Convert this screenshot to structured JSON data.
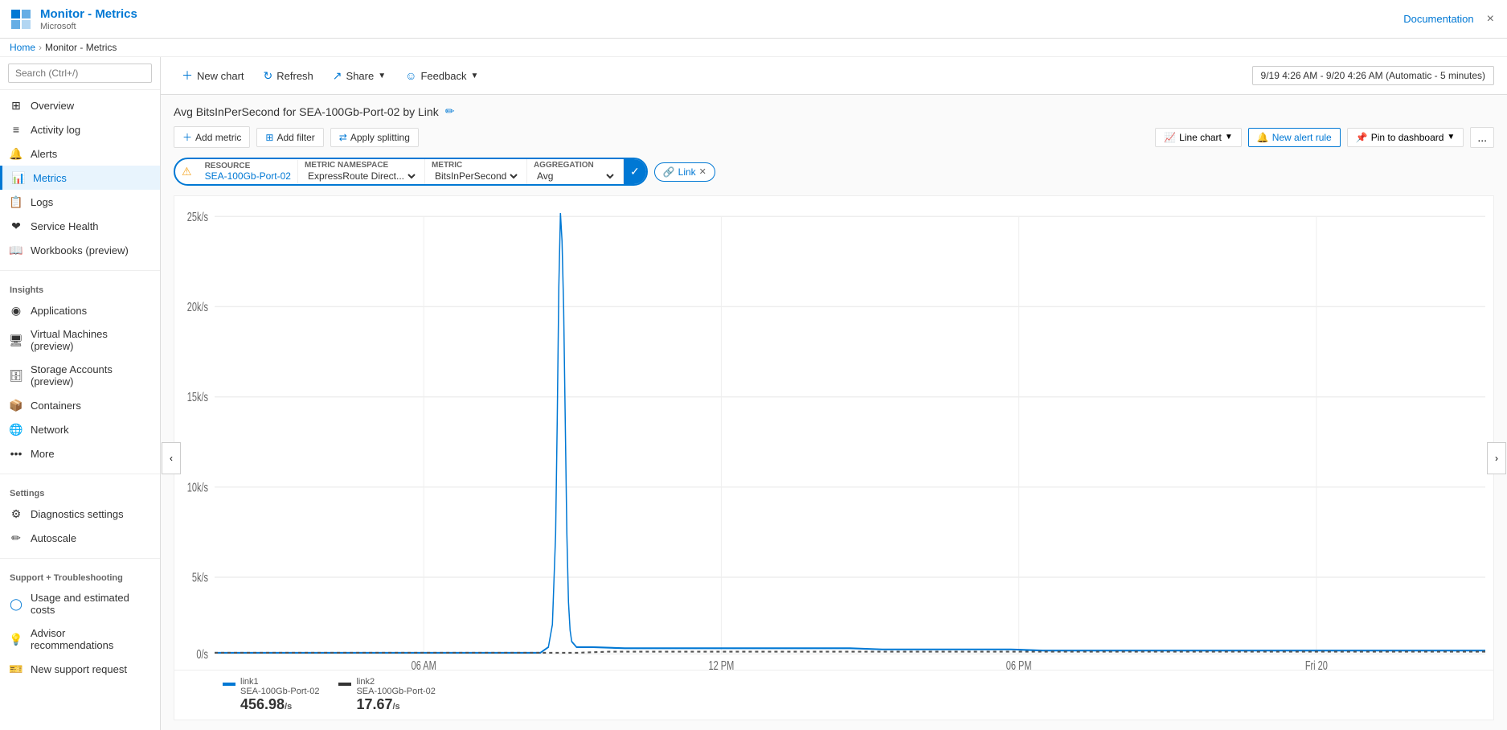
{
  "app": {
    "title": "Monitor - Metrics",
    "subtitle": "Microsoft",
    "documentation_label": "Documentation",
    "close_label": "×"
  },
  "breadcrumb": {
    "home": "Home",
    "current": "Monitor - Metrics"
  },
  "sidebar": {
    "search_placeholder": "Search (Ctrl+/)",
    "items": [
      {
        "id": "overview",
        "label": "Overview",
        "icon": "⊞",
        "active": false
      },
      {
        "id": "activity-log",
        "label": "Activity log",
        "icon": "≡",
        "active": false
      },
      {
        "id": "alerts",
        "label": "Alerts",
        "icon": "🔔",
        "active": false
      },
      {
        "id": "metrics",
        "label": "Metrics",
        "icon": "📊",
        "active": true
      },
      {
        "id": "logs",
        "label": "Logs",
        "icon": "📋",
        "active": false
      },
      {
        "id": "service-health",
        "label": "Service Health",
        "icon": "❤",
        "active": false
      },
      {
        "id": "workbooks",
        "label": "Workbooks (preview)",
        "icon": "📖",
        "active": false
      }
    ],
    "sections": {
      "insights": {
        "label": "Insights",
        "items": [
          {
            "id": "applications",
            "label": "Applications",
            "icon": "◉"
          },
          {
            "id": "virtual-machines",
            "label": "Virtual Machines (preview)",
            "icon": "🖥"
          },
          {
            "id": "storage-accounts",
            "label": "Storage Accounts (preview)",
            "icon": "🗄"
          },
          {
            "id": "containers",
            "label": "Containers",
            "icon": "📦"
          },
          {
            "id": "network",
            "label": "Network",
            "icon": "🌐"
          },
          {
            "id": "more",
            "label": "... More",
            "icon": ""
          }
        ]
      },
      "settings": {
        "label": "Settings",
        "items": [
          {
            "id": "diagnostics",
            "label": "Diagnostics settings",
            "icon": "⚙"
          },
          {
            "id": "autoscale",
            "label": "Autoscale",
            "icon": "✏"
          }
        ]
      },
      "support": {
        "label": "Support + Troubleshooting",
        "items": [
          {
            "id": "usage-costs",
            "label": "Usage and estimated costs",
            "icon": "◯"
          },
          {
            "id": "advisor",
            "label": "Advisor recommendations",
            "icon": "💡"
          },
          {
            "id": "support-request",
            "label": "New support request",
            "icon": "🎫"
          }
        ]
      }
    }
  },
  "toolbar": {
    "new_chart": "New chart",
    "refresh": "Refresh",
    "share": "Share",
    "feedback": "Feedback",
    "time_range": "9/19 4:26 AM - 9/20 4:26 AM (Automatic - 5 minutes)"
  },
  "chart": {
    "title": "Avg BitsInPerSecond for SEA-100Gb-Port-02 by Link",
    "add_metric": "Add metric",
    "add_filter": "Add filter",
    "apply_splitting": "Apply splitting",
    "chart_type": "Line chart",
    "new_alert": "New alert rule",
    "pin_dashboard": "Pin to dashboard",
    "more_options": "...",
    "resource": {
      "label": "RESOURCE",
      "value": "SEA-100Gb-Port-02"
    },
    "metric_namespace": {
      "label": "METRIC NAMESPACE",
      "value": "ExpressRoute Direct..."
    },
    "metric": {
      "label": "METRIC",
      "value": "BitsInPerSecond"
    },
    "aggregation": {
      "label": "AGGREGATION",
      "value": "Avg"
    },
    "link_tag": "Link",
    "y_axis": {
      "labels": [
        "25k/s",
        "20k/s",
        "15k/s",
        "10k/s",
        "5k/s",
        "0/s"
      ]
    },
    "x_axis": {
      "labels": [
        "06 AM",
        "12 PM",
        "06 PM",
        "Fri 20"
      ]
    },
    "legend": [
      {
        "id": "link1",
        "name": "link1",
        "resource": "SEA-100Gb-Port-02",
        "value": "456.98",
        "unit": "/s",
        "color": "#0078d4"
      },
      {
        "id": "link2",
        "name": "link2",
        "resource": "SEA-100Gb-Port-02",
        "value": "17.67",
        "unit": "/s",
        "color": "#333333"
      }
    ]
  }
}
